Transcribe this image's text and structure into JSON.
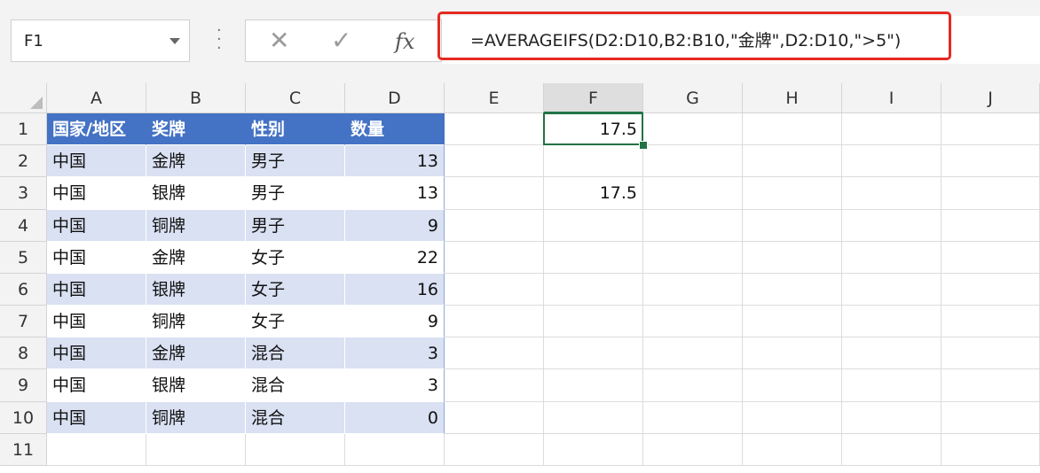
{
  "formula_bar": {
    "name_box": "F1",
    "cancel_icon": "✕",
    "enter_icon": "✓",
    "fx_label": "fx",
    "formula": "=AVERAGEIFS(D2:D10,B2:B10,\"金牌\",D2:D10,\">5\")"
  },
  "columns": [
    "A",
    "B",
    "C",
    "D",
    "E",
    "F",
    "G",
    "H",
    "I",
    "J"
  ],
  "selected_column": "F",
  "rows": [
    "1",
    "2",
    "3",
    "4",
    "5",
    "6",
    "7",
    "8",
    "9",
    "10",
    "11"
  ],
  "table": {
    "header": [
      "国家/地区",
      "奖牌",
      "性别",
      "数量"
    ],
    "rows": [
      [
        "中国",
        "金牌",
        "男子",
        "13"
      ],
      [
        "中国",
        "银牌",
        "男子",
        "13"
      ],
      [
        "中国",
        "铜牌",
        "男子",
        "9"
      ],
      [
        "中国",
        "金牌",
        "女子",
        "22"
      ],
      [
        "中国",
        "银牌",
        "女子",
        "16"
      ],
      [
        "中国",
        "铜牌",
        "女子",
        "9"
      ],
      [
        "中国",
        "金牌",
        "混合",
        "3"
      ],
      [
        "中国",
        "银牌",
        "混合",
        "3"
      ],
      [
        "中国",
        "铜牌",
        "混合",
        "0"
      ]
    ]
  },
  "results": {
    "F1": "17.5",
    "F3": "17.5"
  },
  "colors": {
    "header_fill": "#4472c4",
    "band_fill": "#d9e1f2",
    "selection": "#217346",
    "highlight_box": "#e42a22"
  }
}
